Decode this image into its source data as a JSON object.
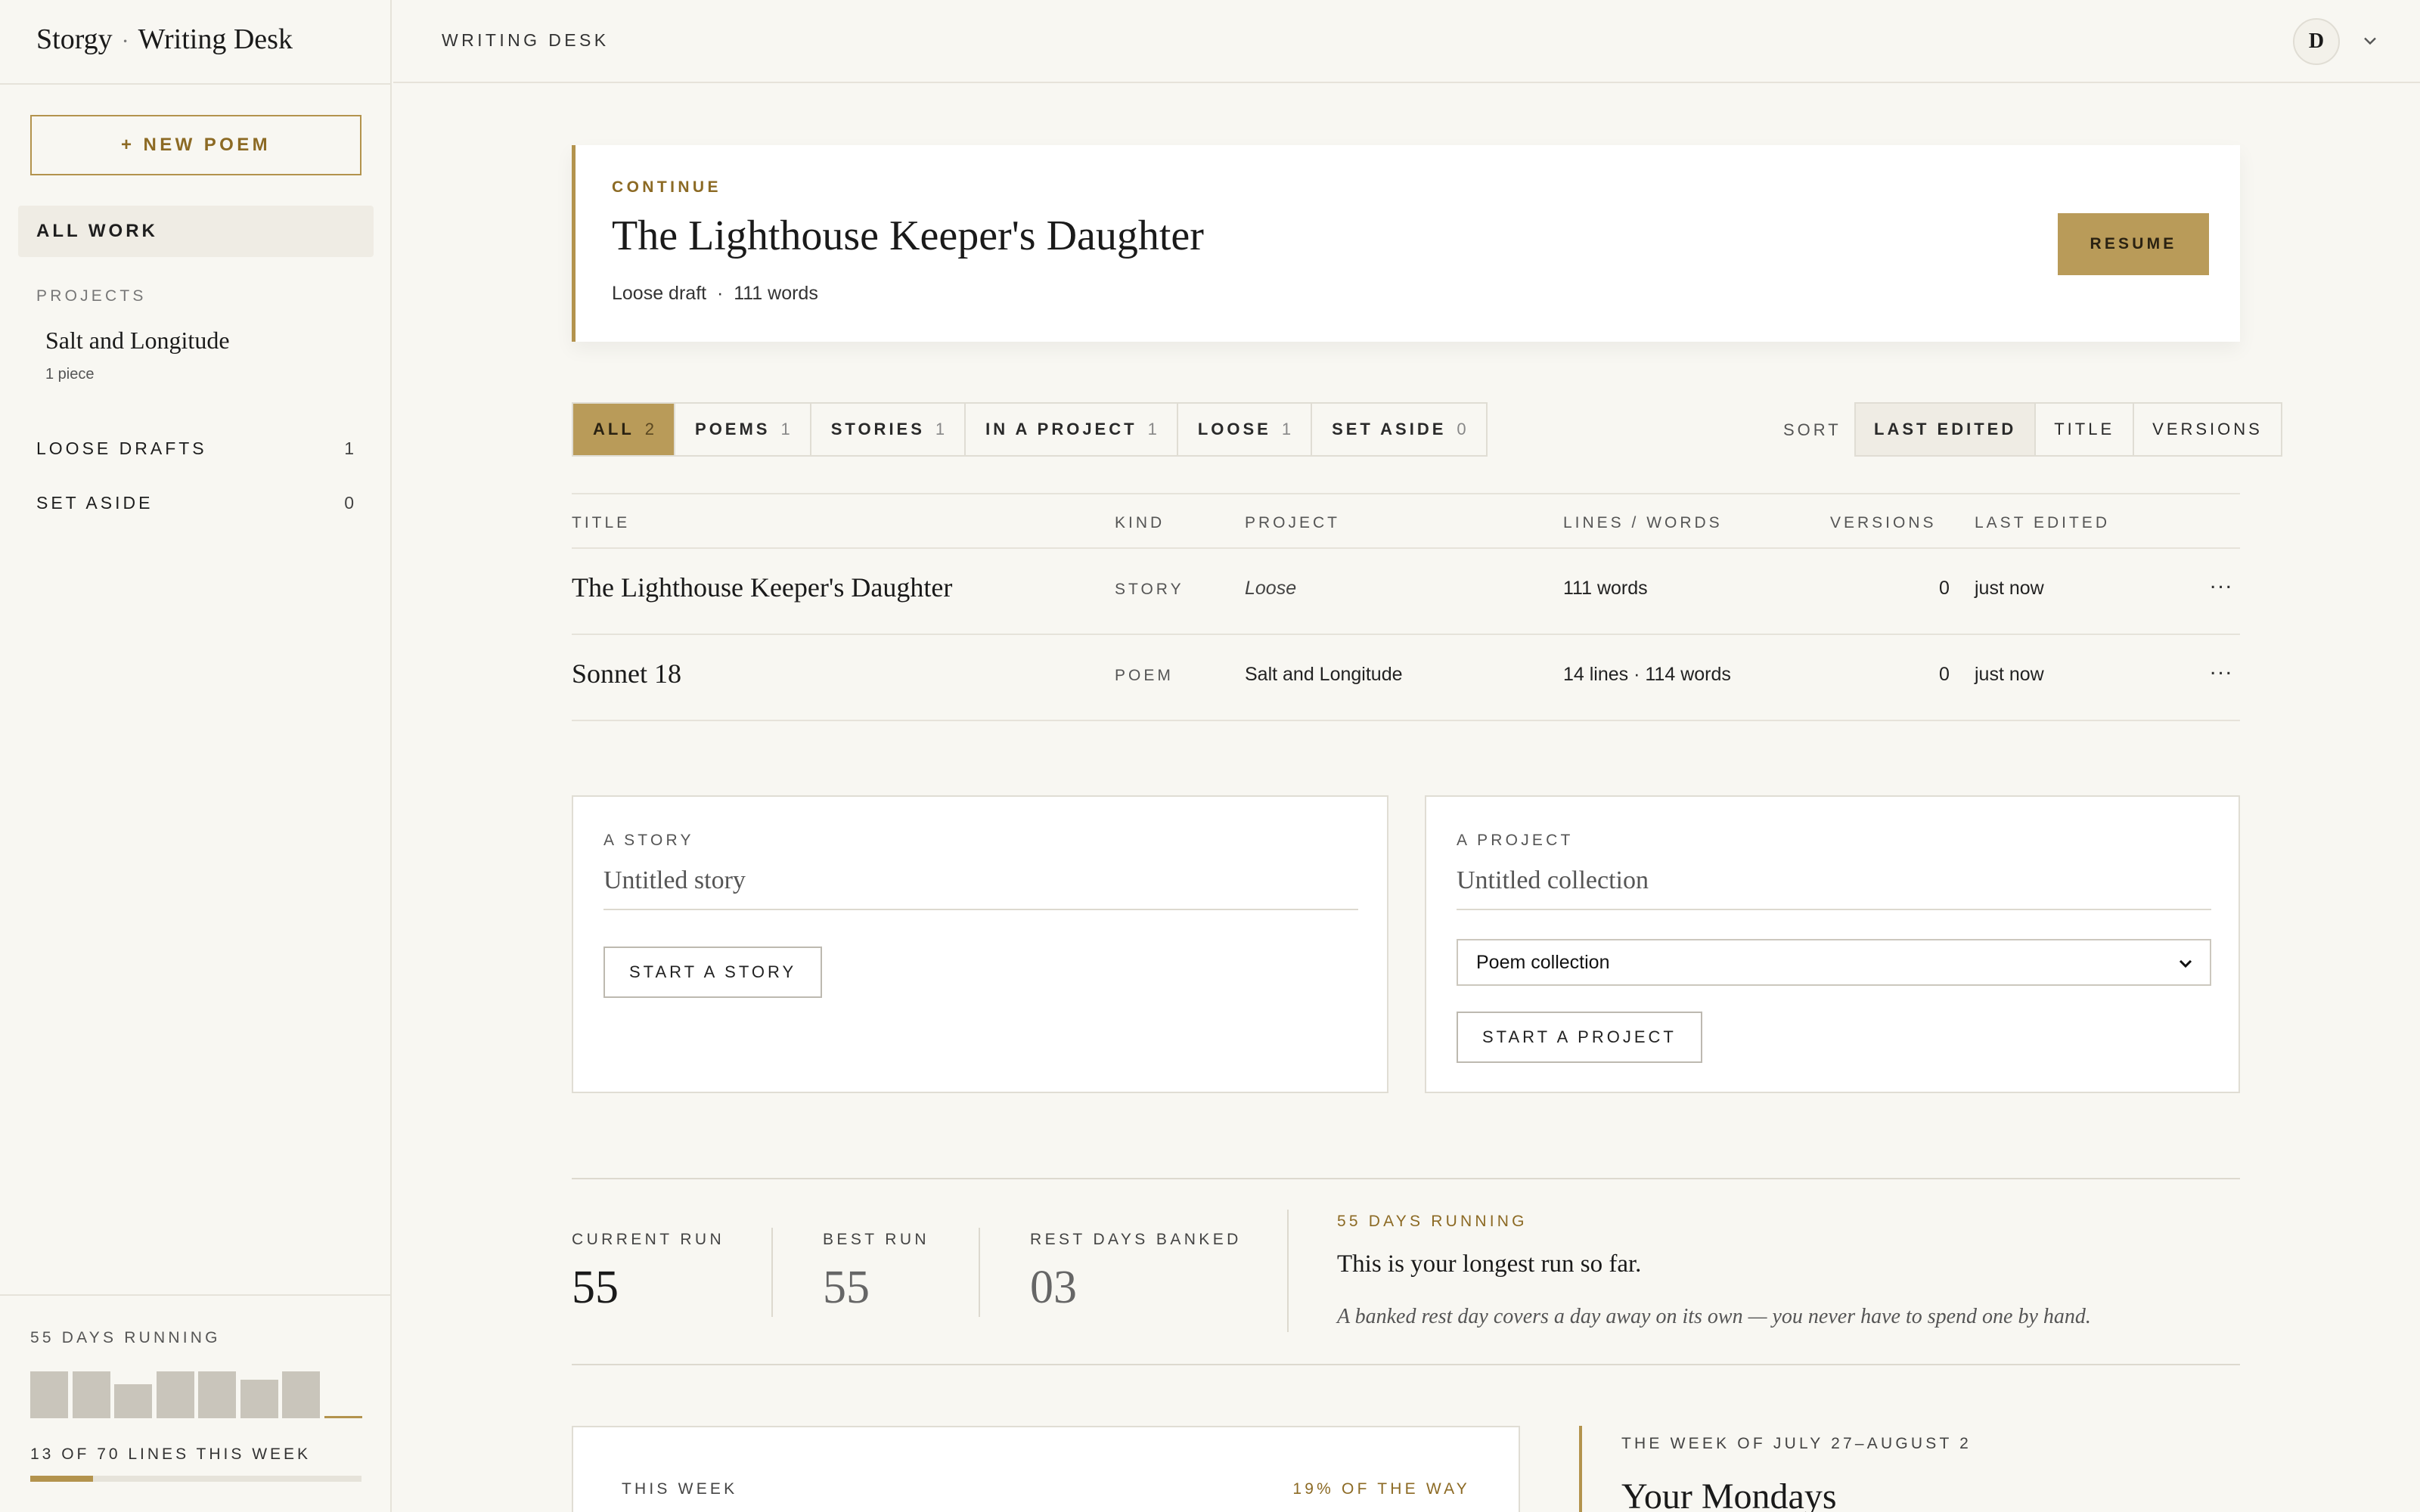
{
  "brand": {
    "name": "Storgy",
    "separator": "·",
    "section": "Writing Desk"
  },
  "sidebar": {
    "new_poem_label": "+ NEW POEM",
    "all_work_label": "ALL WORK",
    "projects_heading": "PROJECTS",
    "projects": [
      {
        "name": "Salt and Longitude",
        "count": "1 piece"
      }
    ],
    "loose_drafts": {
      "label": "LOOSE DRAFTS",
      "count": "1"
    },
    "set_aside": {
      "label": "SET ASIDE",
      "count": "0"
    },
    "streak_label": "55 DAYS RUNNING",
    "week_bars": [
      1.0,
      1.0,
      0.72,
      1.0,
      1.0,
      0.82,
      1.0,
      0.0
    ],
    "lines_label": "13 OF 70 LINES THIS WEEK",
    "lines_progress": 0.19
  },
  "topbar": {
    "title": "WRITING DESK",
    "avatar_initial": "D"
  },
  "continue_card": {
    "eyebrow": "CONTINUE",
    "title": "The Lighthouse Keeper's Daughter",
    "meta": "Loose draft  ·  111 words",
    "resume_label": "RESUME"
  },
  "filters": [
    {
      "label": "ALL",
      "count": "2",
      "active": true
    },
    {
      "label": "POEMS",
      "count": "1",
      "active": false
    },
    {
      "label": "STORIES",
      "count": "1",
      "active": false
    },
    {
      "label": "IN A PROJECT",
      "count": "1",
      "active": false
    },
    {
      "label": "LOOSE",
      "count": "1",
      "active": false
    },
    {
      "label": "SET ASIDE",
      "count": "0",
      "active": false
    }
  ],
  "sort": {
    "label": "SORT",
    "options": [
      {
        "label": "LAST EDITED",
        "active": true
      },
      {
        "label": "TITLE",
        "active": false
      },
      {
        "label": "VERSIONS",
        "active": false
      }
    ]
  },
  "table": {
    "headers": {
      "title": "TITLE",
      "kind": "KIND",
      "project": "PROJECT",
      "lines_words": "LINES / WORDS",
      "versions": "VERSIONS",
      "last_edited": "LAST EDITED"
    },
    "rows": [
      {
        "title": "The Lighthouse Keeper's Daughter",
        "kind": "STORY",
        "project": "Loose",
        "lines_words": "111 words",
        "versions": "0",
        "last_edited": "just now",
        "more": "..."
      },
      {
        "title": "Sonnet 18",
        "kind": "POEM",
        "project": "Salt and Longitude",
        "lines_words": "14 lines · 114 words",
        "versions": "0",
        "last_edited": "just now",
        "more": "..."
      }
    ]
  },
  "story_card": {
    "eyebrow": "A STORY",
    "placeholder": "Untitled story",
    "button": "START A STORY"
  },
  "project_card": {
    "eyebrow": "A PROJECT",
    "placeholder": "Untitled collection",
    "select_value": "Poem collection",
    "button": "START A PROJECT"
  },
  "stats": {
    "current_run": {
      "label": "CURRENT RUN",
      "value": "55"
    },
    "best_run": {
      "label": "BEST RUN",
      "value": "55"
    },
    "rest_days": {
      "label": "REST DAYS BANKED",
      "value": "03"
    },
    "run_eyebrow": "55 DAYS RUNNING",
    "run_title": "This is your longest run so far.",
    "run_note": "A banked rest day covers a day away on its own — you never have to spend one by hand."
  },
  "this_week": {
    "label": "THIS WEEK",
    "progress_label": "19% OF THE WAY"
  },
  "mondays": {
    "eyebrow": "THE WEEK OF JULY 27–AUGUST 2",
    "heading": "Your Mondays"
  },
  "colors": {
    "accent": "#b99b59",
    "accent_text": "#8c6a24",
    "background": "#f8f7f2",
    "border": "#e6e3da"
  }
}
